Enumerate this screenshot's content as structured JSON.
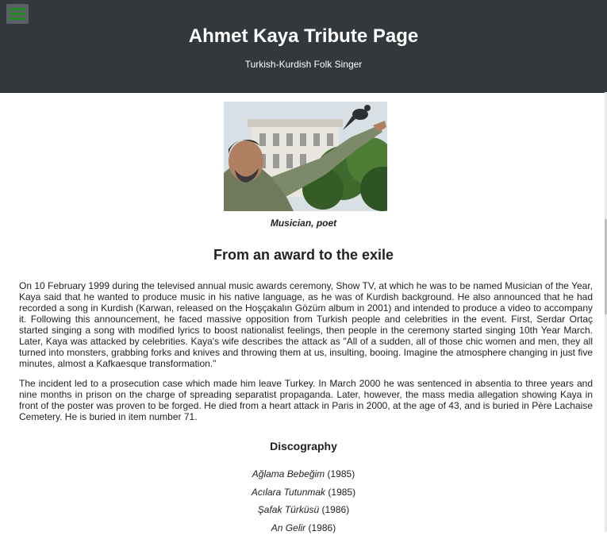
{
  "header": {
    "title": "Ahmet Kaya Tribute Page",
    "subtitle": "Turkish-Kurdish Folk Singer",
    "menu_icon": "hamburger-menu-icon",
    "menu_icon_color": "#1f8a1f",
    "background_color": "#33383c"
  },
  "photo": {
    "caption": "Musician, poet"
  },
  "section": {
    "title": "From an award to the exile",
    "paragraphs": [
      "On 10 February 1999 during the televised annual music awards ceremony, Show TV, at which he was to be named Musician of the Year, Kaya said that he wanted to produce music in his native language, as he was of Kurdish background. He also announced that he had recorded a song in Kurdish (Karwan, released on the Hoşçakalın Gözüm album in 2001) and intended to produce a video to accompany it. Following this announcement, he faced massive opposition from Turkish people and celebrities in the event. First, Serdar Ortaç started singing a song with modified lyrics to boost nationalist feelings, then people in the ceremony started singing 10th Year March. Later, Kaya was attacked by celebrities. Kaya's wife describes the attack as \"All of a sudden, all of those chic women and men, they all turned into monsters, grabbing forks and knives and throwing them at us, insulting, booing. Imagine the atmosphere changing in just five minutes, almost a Kafkaesque transformation.\"",
      "The incident led to a prosecution case which made him leave Turkey. In March 2000 he was sentenced in absentia to three years and nine months in prison on the charge of spreading separatist propaganda. Later, however, the mass media allegation showing Kaya in front of the poster was proven to be forged. He died from a heart attack in Paris in 2000, at the age of 43, and is buried in Père Lachaise Cemetery. He is buried in item number 71."
    ]
  },
  "discography": {
    "title": "Discography",
    "albums": [
      {
        "name": "Ağlama Bebeğim",
        "year": "(1985)"
      },
      {
        "name": "Acılara Tutunmak",
        "year": "(1985)"
      },
      {
        "name": "Şafak Türküsü",
        "year": "(1986)"
      },
      {
        "name": "An Gelir",
        "year": "(1986)"
      }
    ]
  }
}
